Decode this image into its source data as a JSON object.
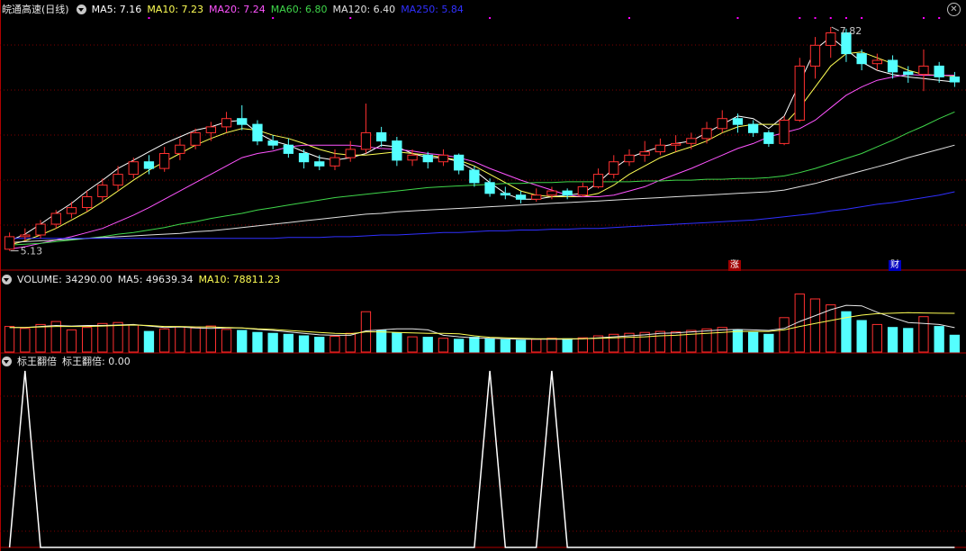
{
  "header": {
    "stock_name": "皖通高速(日线)",
    "ma_labels": [
      {
        "text": "MA5: 7.16",
        "color": "#ffffff"
      },
      {
        "text": "MA10: 7.23",
        "color": "#ffff54"
      },
      {
        "text": "MA20: 7.24",
        "color": "#ff54ff"
      },
      {
        "text": "MA60: 6.80",
        "color": "#3fd64a"
      },
      {
        "text": "MA120: 6.40",
        "color": "#e0e0e0"
      },
      {
        "text": "MA250: 5.84",
        "color": "#3030ff"
      }
    ]
  },
  "volume_header": {
    "label": "VOLUME: 34290.00",
    "ma5": "MA5: 49639.34",
    "ma10": "MA10: 78811.23"
  },
  "indicator_header": {
    "name": "标王翻倍",
    "value": "标王翻倍: 0.00"
  },
  "annotations": {
    "high_label": "7.82",
    "low_label": "5.13",
    "mark_up": "涨",
    "mark_fin": "财"
  },
  "colors": {
    "up": "#ff3030",
    "down": "#54ffff",
    "frame": "#b00000",
    "grid": "#800000",
    "mark_dots": "#ff00ff"
  },
  "chart_data": [
    {
      "type": "candlestick",
      "series": [
        {
          "name": "MA5",
          "values": [
            5.25,
            5.33,
            5.45,
            5.58,
            5.7,
            5.85,
            5.98,
            6.12,
            6.22,
            6.32,
            6.42,
            6.5,
            6.58,
            6.62,
            6.68,
            6.7,
            6.55,
            6.45,
            6.4,
            6.32,
            6.25,
            6.22,
            6.25,
            6.3,
            6.4,
            6.38,
            6.3,
            6.25,
            6.25,
            6.2,
            6.1,
            5.95,
            5.82,
            5.75,
            5.75,
            5.78,
            5.8,
            5.82,
            5.95,
            6.12,
            6.25,
            6.32,
            6.38,
            6.42,
            6.45,
            6.55,
            6.65,
            6.75,
            6.72,
            6.6,
            6.75,
            7.15,
            7.55,
            7.7,
            7.55,
            7.4,
            7.3,
            7.25,
            7.22,
            7.2,
            7.18,
            7.16
          ]
        },
        {
          "name": "MA10",
          "values": [
            5.2,
            5.25,
            5.32,
            5.4,
            5.5,
            5.6,
            5.72,
            5.85,
            5.98,
            6.1,
            6.2,
            6.3,
            6.4,
            6.48,
            6.55,
            6.6,
            6.58,
            6.52,
            6.48,
            6.42,
            6.35,
            6.3,
            6.28,
            6.28,
            6.3,
            6.32,
            6.3,
            6.28,
            6.25,
            6.22,
            6.15,
            6.05,
            5.95,
            5.85,
            5.8,
            5.78,
            5.78,
            5.78,
            5.82,
            5.92,
            6.05,
            6.15,
            6.25,
            6.32,
            6.38,
            6.45,
            6.55,
            6.62,
            6.65,
            6.65,
            6.65,
            6.85,
            7.1,
            7.35,
            7.5,
            7.52,
            7.45,
            7.38,
            7.3,
            7.25,
            7.24,
            7.23
          ]
        },
        {
          "name": "MA20",
          "values": [
            5.15,
            5.18,
            5.22,
            5.26,
            5.3,
            5.35,
            5.4,
            5.48,
            5.56,
            5.65,
            5.75,
            5.85,
            5.95,
            6.05,
            6.15,
            6.25,
            6.3,
            6.33,
            6.38,
            6.4,
            6.4,
            6.4,
            6.4,
            6.38,
            6.36,
            6.35,
            6.33,
            6.3,
            6.28,
            6.25,
            6.2,
            6.12,
            6.05,
            5.98,
            5.92,
            5.86,
            5.8,
            5.78,
            5.78,
            5.8,
            5.85,
            5.9,
            5.98,
            6.05,
            6.12,
            6.2,
            6.28,
            6.36,
            6.42,
            6.5,
            6.55,
            6.6,
            6.7,
            6.85,
            7.0,
            7.1,
            7.18,
            7.22,
            7.25,
            7.24,
            7.24,
            7.24
          ]
        },
        {
          "name": "MA60",
          "values": [
            5.2,
            5.21,
            5.22,
            5.24,
            5.26,
            5.28,
            5.3,
            5.33,
            5.35,
            5.38,
            5.41,
            5.45,
            5.48,
            5.52,
            5.55,
            5.58,
            5.62,
            5.65,
            5.68,
            5.71,
            5.74,
            5.77,
            5.79,
            5.81,
            5.83,
            5.85,
            5.87,
            5.89,
            5.9,
            5.91,
            5.92,
            5.93,
            5.94,
            5.94,
            5.95,
            5.95,
            5.96,
            5.96,
            5.96,
            5.96,
            5.96,
            5.97,
            5.97,
            5.98,
            5.98,
            5.99,
            5.99,
            6.0,
            6.0,
            6.01,
            6.03,
            6.07,
            6.12,
            6.18,
            6.24,
            6.3,
            6.38,
            6.46,
            6.55,
            6.63,
            6.72,
            6.8
          ]
        },
        {
          "name": "MA120",
          "values": [
            5.23,
            5.24,
            5.25,
            5.26,
            5.27,
            5.28,
            5.29,
            5.3,
            5.31,
            5.32,
            5.33,
            5.34,
            5.36,
            5.37,
            5.39,
            5.41,
            5.43,
            5.45,
            5.47,
            5.49,
            5.51,
            5.53,
            5.55,
            5.57,
            5.58,
            5.6,
            5.61,
            5.62,
            5.63,
            5.64,
            5.65,
            5.66,
            5.67,
            5.68,
            5.69,
            5.7,
            5.71,
            5.72,
            5.73,
            5.74,
            5.75,
            5.76,
            5.77,
            5.78,
            5.79,
            5.8,
            5.81,
            5.82,
            5.83,
            5.84,
            5.86,
            5.9,
            5.94,
            5.99,
            6.04,
            6.09,
            6.14,
            6.19,
            6.25,
            6.3,
            6.35,
            6.4
          ]
        },
        {
          "name": "MA250",
          "values": [
            5.28,
            5.28,
            5.28,
            5.28,
            5.28,
            5.28,
            5.28,
            5.28,
            5.28,
            5.28,
            5.28,
            5.28,
            5.28,
            5.28,
            5.28,
            5.28,
            5.28,
            5.28,
            5.29,
            5.29,
            5.29,
            5.3,
            5.3,
            5.31,
            5.32,
            5.32,
            5.33,
            5.34,
            5.35,
            5.35,
            5.36,
            5.37,
            5.37,
            5.38,
            5.38,
            5.39,
            5.39,
            5.4,
            5.4,
            5.41,
            5.42,
            5.43,
            5.44,
            5.45,
            5.46,
            5.47,
            5.48,
            5.49,
            5.5,
            5.52,
            5.54,
            5.56,
            5.58,
            5.61,
            5.63,
            5.66,
            5.69,
            5.71,
            5.74,
            5.77,
            5.8,
            5.84
          ]
        }
      ],
      "candles": [
        [
          5.15,
          5.3,
          5.35,
          5.13
        ],
        [
          5.3,
          5.32,
          5.4,
          5.25
        ],
        [
          5.32,
          5.45,
          5.5,
          5.28
        ],
        [
          5.45,
          5.58,
          5.62,
          5.4
        ],
        [
          5.58,
          5.65,
          5.72,
          5.52
        ],
        [
          5.65,
          5.78,
          5.85,
          5.6
        ],
        [
          5.78,
          5.92,
          6.0,
          5.72
        ],
        [
          5.92,
          6.05,
          6.15,
          5.85
        ],
        [
          6.05,
          6.2,
          6.25,
          6.0
        ],
        [
          6.2,
          6.12,
          6.28,
          6.05
        ],
        [
          6.12,
          6.3,
          6.38,
          6.08
        ],
        [
          6.3,
          6.4,
          6.48,
          6.22
        ],
        [
          6.4,
          6.55,
          6.6,
          6.35
        ],
        [
          6.55,
          6.62,
          6.68,
          6.45
        ],
        [
          6.62,
          6.72,
          6.8,
          6.55
        ],
        [
          6.72,
          6.65,
          6.88,
          6.58
        ],
        [
          6.65,
          6.45,
          6.7,
          6.4
        ],
        [
          6.45,
          6.4,
          6.52,
          6.35
        ],
        [
          6.4,
          6.3,
          6.48,
          6.25
        ],
        [
          6.3,
          6.2,
          6.35,
          6.12
        ],
        [
          6.2,
          6.15,
          6.28,
          6.1
        ],
        [
          6.15,
          6.25,
          6.35,
          6.1
        ],
        [
          6.25,
          6.35,
          6.45,
          6.2
        ],
        [
          6.35,
          6.55,
          6.9,
          6.3
        ],
        [
          6.55,
          6.45,
          6.62,
          6.38
        ],
        [
          6.45,
          6.22,
          6.5,
          6.15
        ],
        [
          6.22,
          6.28,
          6.35,
          6.15
        ],
        [
          6.28,
          6.2,
          6.32,
          6.12
        ],
        [
          6.2,
          6.28,
          6.35,
          6.15
        ],
        [
          6.28,
          6.1,
          6.3,
          6.05
        ],
        [
          6.1,
          5.95,
          6.15,
          5.9
        ],
        [
          5.95,
          5.82,
          6.0,
          5.78
        ],
        [
          5.82,
          5.8,
          5.9,
          5.75
        ],
        [
          5.8,
          5.75,
          5.85,
          5.7
        ],
        [
          5.75,
          5.8,
          5.88,
          5.72
        ],
        [
          5.8,
          5.85,
          5.9,
          5.75
        ],
        [
          5.85,
          5.8,
          5.88,
          5.75
        ],
        [
          5.8,
          5.9,
          5.95,
          5.78
        ],
        [
          5.9,
          6.05,
          6.12,
          5.88
        ],
        [
          6.05,
          6.2,
          6.28,
          6.0
        ],
        [
          6.2,
          6.28,
          6.35,
          6.15
        ],
        [
          6.28,
          6.32,
          6.45,
          6.2
        ],
        [
          6.32,
          6.4,
          6.48,
          6.28
        ],
        [
          6.4,
          6.42,
          6.52,
          6.32
        ],
        [
          6.42,
          6.48,
          6.55,
          6.35
        ],
        [
          6.48,
          6.6,
          6.68,
          6.42
        ],
        [
          6.6,
          6.72,
          6.82,
          6.55
        ],
        [
          6.72,
          6.65,
          6.78,
          6.55
        ],
        [
          6.65,
          6.55,
          6.7,
          6.5
        ],
        [
          6.55,
          6.42,
          6.58,
          6.38
        ],
        [
          6.42,
          6.7,
          6.75,
          6.4
        ],
        [
          6.7,
          7.35,
          7.45,
          6.68
        ],
        [
          7.35,
          7.6,
          7.7,
          7.2
        ],
        [
          7.6,
          7.75,
          7.82,
          7.45
        ],
        [
          7.75,
          7.5,
          7.8,
          7.4
        ],
        [
          7.5,
          7.38,
          7.55,
          7.3
        ],
        [
          7.38,
          7.42,
          7.5,
          7.3
        ],
        [
          7.42,
          7.28,
          7.48,
          7.2
        ],
        [
          7.28,
          7.25,
          7.35,
          7.15
        ],
        [
          7.25,
          7.35,
          7.55,
          7.05
        ],
        [
          7.35,
          7.22,
          7.4,
          7.15
        ],
        [
          7.22,
          7.16,
          7.28,
          7.1
        ]
      ],
      "ylim": [
        5.05,
        7.95
      ],
      "high": 7.82,
      "low": 5.13
    },
    {
      "type": "bar",
      "values": [
        52000,
        48000,
        56000,
        62000,
        45000,
        50000,
        58000,
        60000,
        55000,
        42000,
        47000,
        51000,
        49000,
        53000,
        46000,
        44000,
        40000,
        38000,
        36000,
        33000,
        30000,
        32000,
        38000,
        82000,
        44000,
        39000,
        31000,
        30000,
        28000,
        26000,
        30000,
        27000,
        25000,
        24000,
        26000,
        28000,
        27000,
        29000,
        33000,
        36000,
        38000,
        40000,
        42000,
        41000,
        44000,
        47000,
        50000,
        45000,
        40000,
        36000,
        70000,
        118000,
        108000,
        96000,
        82000,
        64000,
        56000,
        50000,
        48000,
        72000,
        52000,
        34290
      ],
      "ylim": [
        0,
        130000
      ],
      "series": [
        {
          "name": "MA5",
          "values": [
            50000,
            50000,
            52000,
            54000,
            53000,
            54000,
            54000,
            55000,
            56000,
            53000,
            50000,
            51000,
            49000,
            48000,
            49000,
            49000,
            46000,
            44000,
            41000,
            38000,
            35000,
            34000,
            34000,
            43000,
            45000,
            47000,
            47000,
            45000,
            34000,
            31000,
            29000,
            28000,
            27000,
            26000,
            26000,
            26000,
            26000,
            27000,
            29000,
            31000,
            33000,
            35000,
            38000,
            39000,
            41000,
            43000,
            45000,
            46000,
            45000,
            44000,
            48000,
            62000,
            74000,
            86000,
            95000,
            94000,
            81000,
            70000,
            60000,
            58000,
            56000,
            49639
          ]
        },
        {
          "name": "MA10",
          "values": [
            50000,
            50000,
            51000,
            52000,
            52000,
            52000,
            53000,
            54000,
            55000,
            54000,
            52000,
            52000,
            51000,
            51000,
            50000,
            49000,
            47000,
            46000,
            44000,
            42000,
            40000,
            38000,
            37000,
            41000,
            41000,
            40000,
            39000,
            38000,
            38000,
            37000,
            33000,
            30000,
            29000,
            28000,
            27000,
            27000,
            27000,
            27000,
            28000,
            29000,
            30000,
            31000,
            33000,
            34000,
            36000,
            38000,
            40000,
            42000,
            42000,
            42000,
            45000,
            52000,
            58000,
            64000,
            70000,
            75000,
            78000,
            79000,
            80000,
            79500,
            79000,
            78811
          ]
        }
      ]
    },
    {
      "type": "line",
      "values": [
        0,
        1,
        0,
        0,
        0,
        0,
        0,
        0,
        0,
        0,
        0,
        0,
        0,
        0,
        0,
        0,
        0,
        0,
        0,
        0,
        0,
        0,
        0,
        0,
        0,
        0,
        0,
        0,
        0,
        0,
        0,
        1,
        0,
        0,
        0,
        1,
        0,
        0,
        0,
        0,
        0,
        0,
        0,
        0,
        0,
        0,
        0,
        0,
        0,
        0,
        0,
        0,
        0,
        0,
        0,
        0,
        0,
        0,
        0,
        0,
        0,
        0
      ],
      "ylim": [
        0,
        1
      ]
    }
  ]
}
